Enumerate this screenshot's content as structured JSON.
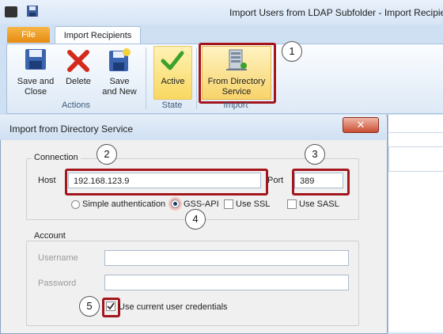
{
  "window": {
    "title": "Import Users from LDAP Subfolder - Import Recipients"
  },
  "tabs": {
    "file": "File",
    "import_recipients": "Import Recipients"
  },
  "ribbon": {
    "save_close": [
      "Save and",
      "Close"
    ],
    "delete": "Delete",
    "save_new": [
      "Save",
      "and New"
    ],
    "active": "Active",
    "from_directory": [
      "From Directory",
      "Service"
    ],
    "groups": {
      "actions": "Actions",
      "state": "State",
      "import": "Import"
    }
  },
  "dialog": {
    "title": "Import from Directory Service",
    "connection_legend": "Connection",
    "host_label": "Host",
    "host_value": "192.168.123.9",
    "port_label": "Port",
    "port_value": "389",
    "auth_simple": "Simple authentication",
    "auth_gss": "GSS-API",
    "use_ssl": "Use SSL",
    "use_sasl": "Use SASL",
    "account_legend": "Account",
    "username_label": "Username",
    "password_label": "Password",
    "use_current": "Use current user credentials"
  },
  "callouts": [
    "1",
    "2",
    "3",
    "4",
    "5"
  ],
  "colors": {
    "callout": "#a3161c",
    "accent_file_tab": "#e58b12",
    "active_highlight": "#f8d860"
  }
}
